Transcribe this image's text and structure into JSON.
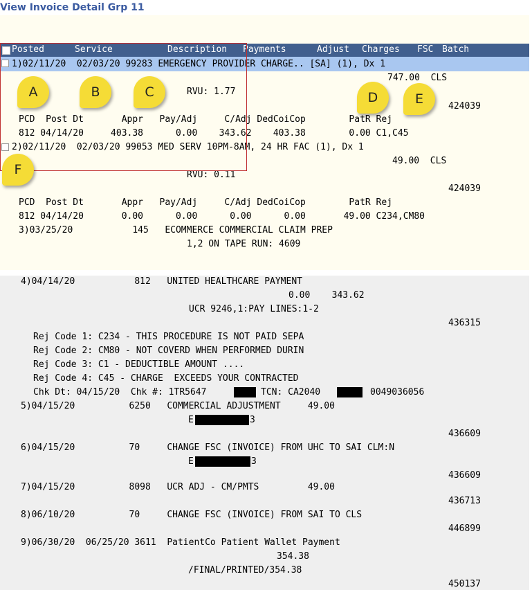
{
  "page_title": "View Invoice Detail Grp 11",
  "header": {
    "posted": "Posted",
    "service": "Service",
    "description": "Description",
    "payments": "Payments",
    "adjust": "Adjust",
    "charges": "Charges",
    "fsc": "FSC",
    "batch": "Batch"
  },
  "markers": [
    "A",
    "B",
    "C",
    "D",
    "E",
    "F"
  ],
  "lines": {
    "i1_main": "1)02/11/20  02/03/20 99283 EMERGENCY PROVIDER CHARGE.. [SA] (1), Dx 1",
    "i1_charge": "747.00  CLS",
    "i1_rvu": "RVU: 1.77",
    "i1_batch": "424039",
    "i1_hdr": "PCD  Post Dt       Appr   Pay/Adj     C/Adj DedCoiCop        PatR Rej",
    "i1_row": "812 04/14/20     403.38      0.00    343.62    403.38        0.00 C1,C45",
    "i2_main": "2)02/11/20  02/03/20 99053 MED SERV 10PM-8AM, 24 HR FAC (1), Dx 1",
    "i2_charge": "49.00  CLS",
    "i2_rvu": "RVU: 0.11",
    "i2_batch": "424039",
    "i2_hdr": "PCD  Post Dt       Appr   Pay/Adj     C/Adj DedCoiCop        PatR Rej",
    "i2_row": "812 04/14/20       0.00      0.00      0.00      0.00       49.00 C234,CM80",
    "i3_main": "3)03/25/20           145   ECOMMERCE COMMERCIAL CLAIM PREP",
    "i3_sub": "1,2 ON TAPE RUN: 4609",
    "i4_main": "4)04/14/20           812   UNITED HEALTHCARE PAYMENT",
    "i4_amts": "0.00    343.62",
    "i4_ucr": "UCR 9246,1:PAY LINES:1-2",
    "i4_batch": "436315",
    "rej1": "Rej Code 1: C234 - THIS PROCEDURE IS NOT PAID SEPA",
    "rej2": "Rej Code 2: CM80 - NOT COVERD WHEN PERFORMED DURIN",
    "rej3": "Rej Code 3: C1 - DEDUCTIBLE AMOUNT ....",
    "rej4": "Rej Code 4: C45 - CHARGE  EXCEEDS YOUR CONTRACTED",
    "chk_a": "Chk Dt: 04/15/20  Chk #: 1TR5647",
    "chk_b": "TCN: CA2040",
    "chk_c": "0049036056",
    "i5_main": "5)04/15/20          6250   COMMERCIAL ADJUSTMENT     49.00",
    "i5_ref_a": "E",
    "i5_ref_b": "3",
    "i5_batch": "436609",
    "i6_main": "6)04/15/20          70     CHANGE FSC (INVOICE) FROM UHC TO SAI CLM:N",
    "i6_ref_a": "E",
    "i6_ref_b": "3",
    "i6_batch": "436609",
    "i7_main": "7)04/15/20          8098   UCR ADJ - CM/PMTS         49.00",
    "i7_batch": "436713",
    "i8_main": "8)06/10/20          70     CHANGE FSC (INVOICE) FROM SAI TO CLS",
    "i8_batch": "446899",
    "i9_main": "9)06/30/20  06/25/20 3611  PatientCo Patient Wallet Payment",
    "i9_amt": "354.38",
    "i9_sub": "/FINAL/PRINTED/354.38",
    "i9_batch": "450137"
  }
}
